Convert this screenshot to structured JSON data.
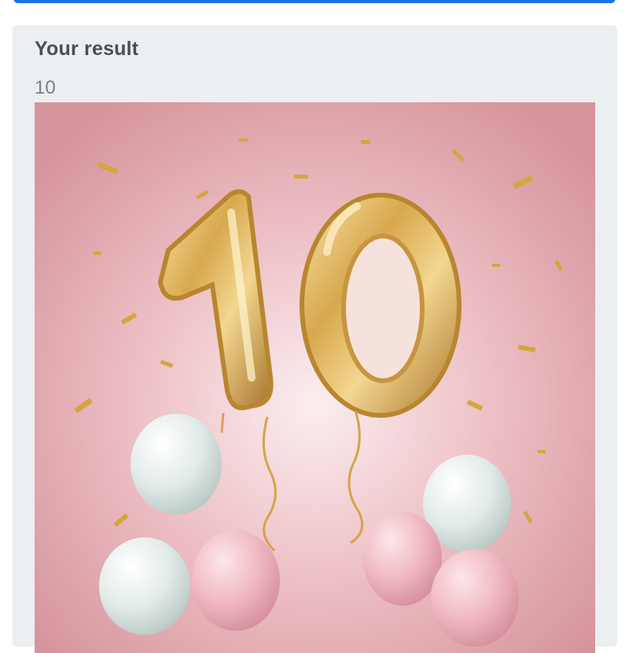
{
  "page": {
    "accent_color": "#1a73e8",
    "card_background": "#eceff1"
  },
  "result": {
    "title": "Your result",
    "value": "10",
    "image": {
      "depicts": "gold-foil-number-10-balloons",
      "balloon_text": "10",
      "background_color": "#dba0a6"
    }
  }
}
